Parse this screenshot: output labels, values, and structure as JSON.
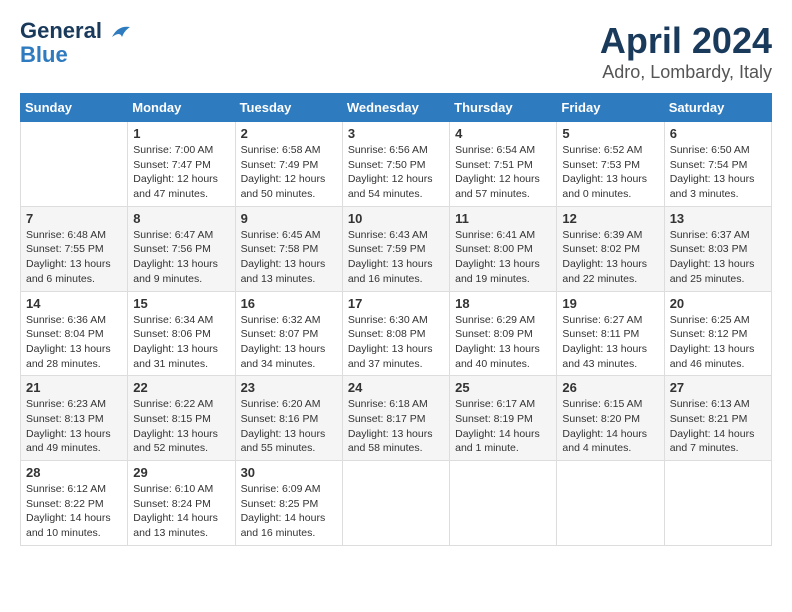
{
  "header": {
    "logo_line1": "General",
    "logo_line2": "Blue",
    "title": "April 2024",
    "subtitle": "Adro, Lombardy, Italy"
  },
  "calendar": {
    "days_of_week": [
      "Sunday",
      "Monday",
      "Tuesday",
      "Wednesday",
      "Thursday",
      "Friday",
      "Saturday"
    ],
    "weeks": [
      [
        {
          "day": "",
          "info": ""
        },
        {
          "day": "1",
          "info": "Sunrise: 7:00 AM\nSunset: 7:47 PM\nDaylight: 12 hours\nand 47 minutes."
        },
        {
          "day": "2",
          "info": "Sunrise: 6:58 AM\nSunset: 7:49 PM\nDaylight: 12 hours\nand 50 minutes."
        },
        {
          "day": "3",
          "info": "Sunrise: 6:56 AM\nSunset: 7:50 PM\nDaylight: 12 hours\nand 54 minutes."
        },
        {
          "day": "4",
          "info": "Sunrise: 6:54 AM\nSunset: 7:51 PM\nDaylight: 12 hours\nand 57 minutes."
        },
        {
          "day": "5",
          "info": "Sunrise: 6:52 AM\nSunset: 7:53 PM\nDaylight: 13 hours\nand 0 minutes."
        },
        {
          "day": "6",
          "info": "Sunrise: 6:50 AM\nSunset: 7:54 PM\nDaylight: 13 hours\nand 3 minutes."
        }
      ],
      [
        {
          "day": "7",
          "info": "Sunrise: 6:48 AM\nSunset: 7:55 PM\nDaylight: 13 hours\nand 6 minutes."
        },
        {
          "day": "8",
          "info": "Sunrise: 6:47 AM\nSunset: 7:56 PM\nDaylight: 13 hours\nand 9 minutes."
        },
        {
          "day": "9",
          "info": "Sunrise: 6:45 AM\nSunset: 7:58 PM\nDaylight: 13 hours\nand 13 minutes."
        },
        {
          "day": "10",
          "info": "Sunrise: 6:43 AM\nSunset: 7:59 PM\nDaylight: 13 hours\nand 16 minutes."
        },
        {
          "day": "11",
          "info": "Sunrise: 6:41 AM\nSunset: 8:00 PM\nDaylight: 13 hours\nand 19 minutes."
        },
        {
          "day": "12",
          "info": "Sunrise: 6:39 AM\nSunset: 8:02 PM\nDaylight: 13 hours\nand 22 minutes."
        },
        {
          "day": "13",
          "info": "Sunrise: 6:37 AM\nSunset: 8:03 PM\nDaylight: 13 hours\nand 25 minutes."
        }
      ],
      [
        {
          "day": "14",
          "info": "Sunrise: 6:36 AM\nSunset: 8:04 PM\nDaylight: 13 hours\nand 28 minutes."
        },
        {
          "day": "15",
          "info": "Sunrise: 6:34 AM\nSunset: 8:06 PM\nDaylight: 13 hours\nand 31 minutes."
        },
        {
          "day": "16",
          "info": "Sunrise: 6:32 AM\nSunset: 8:07 PM\nDaylight: 13 hours\nand 34 minutes."
        },
        {
          "day": "17",
          "info": "Sunrise: 6:30 AM\nSunset: 8:08 PM\nDaylight: 13 hours\nand 37 minutes."
        },
        {
          "day": "18",
          "info": "Sunrise: 6:29 AM\nSunset: 8:09 PM\nDaylight: 13 hours\nand 40 minutes."
        },
        {
          "day": "19",
          "info": "Sunrise: 6:27 AM\nSunset: 8:11 PM\nDaylight: 13 hours\nand 43 minutes."
        },
        {
          "day": "20",
          "info": "Sunrise: 6:25 AM\nSunset: 8:12 PM\nDaylight: 13 hours\nand 46 minutes."
        }
      ],
      [
        {
          "day": "21",
          "info": "Sunrise: 6:23 AM\nSunset: 8:13 PM\nDaylight: 13 hours\nand 49 minutes."
        },
        {
          "day": "22",
          "info": "Sunrise: 6:22 AM\nSunset: 8:15 PM\nDaylight: 13 hours\nand 52 minutes."
        },
        {
          "day": "23",
          "info": "Sunrise: 6:20 AM\nSunset: 8:16 PM\nDaylight: 13 hours\nand 55 minutes."
        },
        {
          "day": "24",
          "info": "Sunrise: 6:18 AM\nSunset: 8:17 PM\nDaylight: 13 hours\nand 58 minutes."
        },
        {
          "day": "25",
          "info": "Sunrise: 6:17 AM\nSunset: 8:19 PM\nDaylight: 14 hours\nand 1 minute."
        },
        {
          "day": "26",
          "info": "Sunrise: 6:15 AM\nSunset: 8:20 PM\nDaylight: 14 hours\nand 4 minutes."
        },
        {
          "day": "27",
          "info": "Sunrise: 6:13 AM\nSunset: 8:21 PM\nDaylight: 14 hours\nand 7 minutes."
        }
      ],
      [
        {
          "day": "28",
          "info": "Sunrise: 6:12 AM\nSunset: 8:22 PM\nDaylight: 14 hours\nand 10 minutes."
        },
        {
          "day": "29",
          "info": "Sunrise: 6:10 AM\nSunset: 8:24 PM\nDaylight: 14 hours\nand 13 minutes."
        },
        {
          "day": "30",
          "info": "Sunrise: 6:09 AM\nSunset: 8:25 PM\nDaylight: 14 hours\nand 16 minutes."
        },
        {
          "day": "",
          "info": ""
        },
        {
          "day": "",
          "info": ""
        },
        {
          "day": "",
          "info": ""
        },
        {
          "day": "",
          "info": ""
        }
      ]
    ]
  }
}
